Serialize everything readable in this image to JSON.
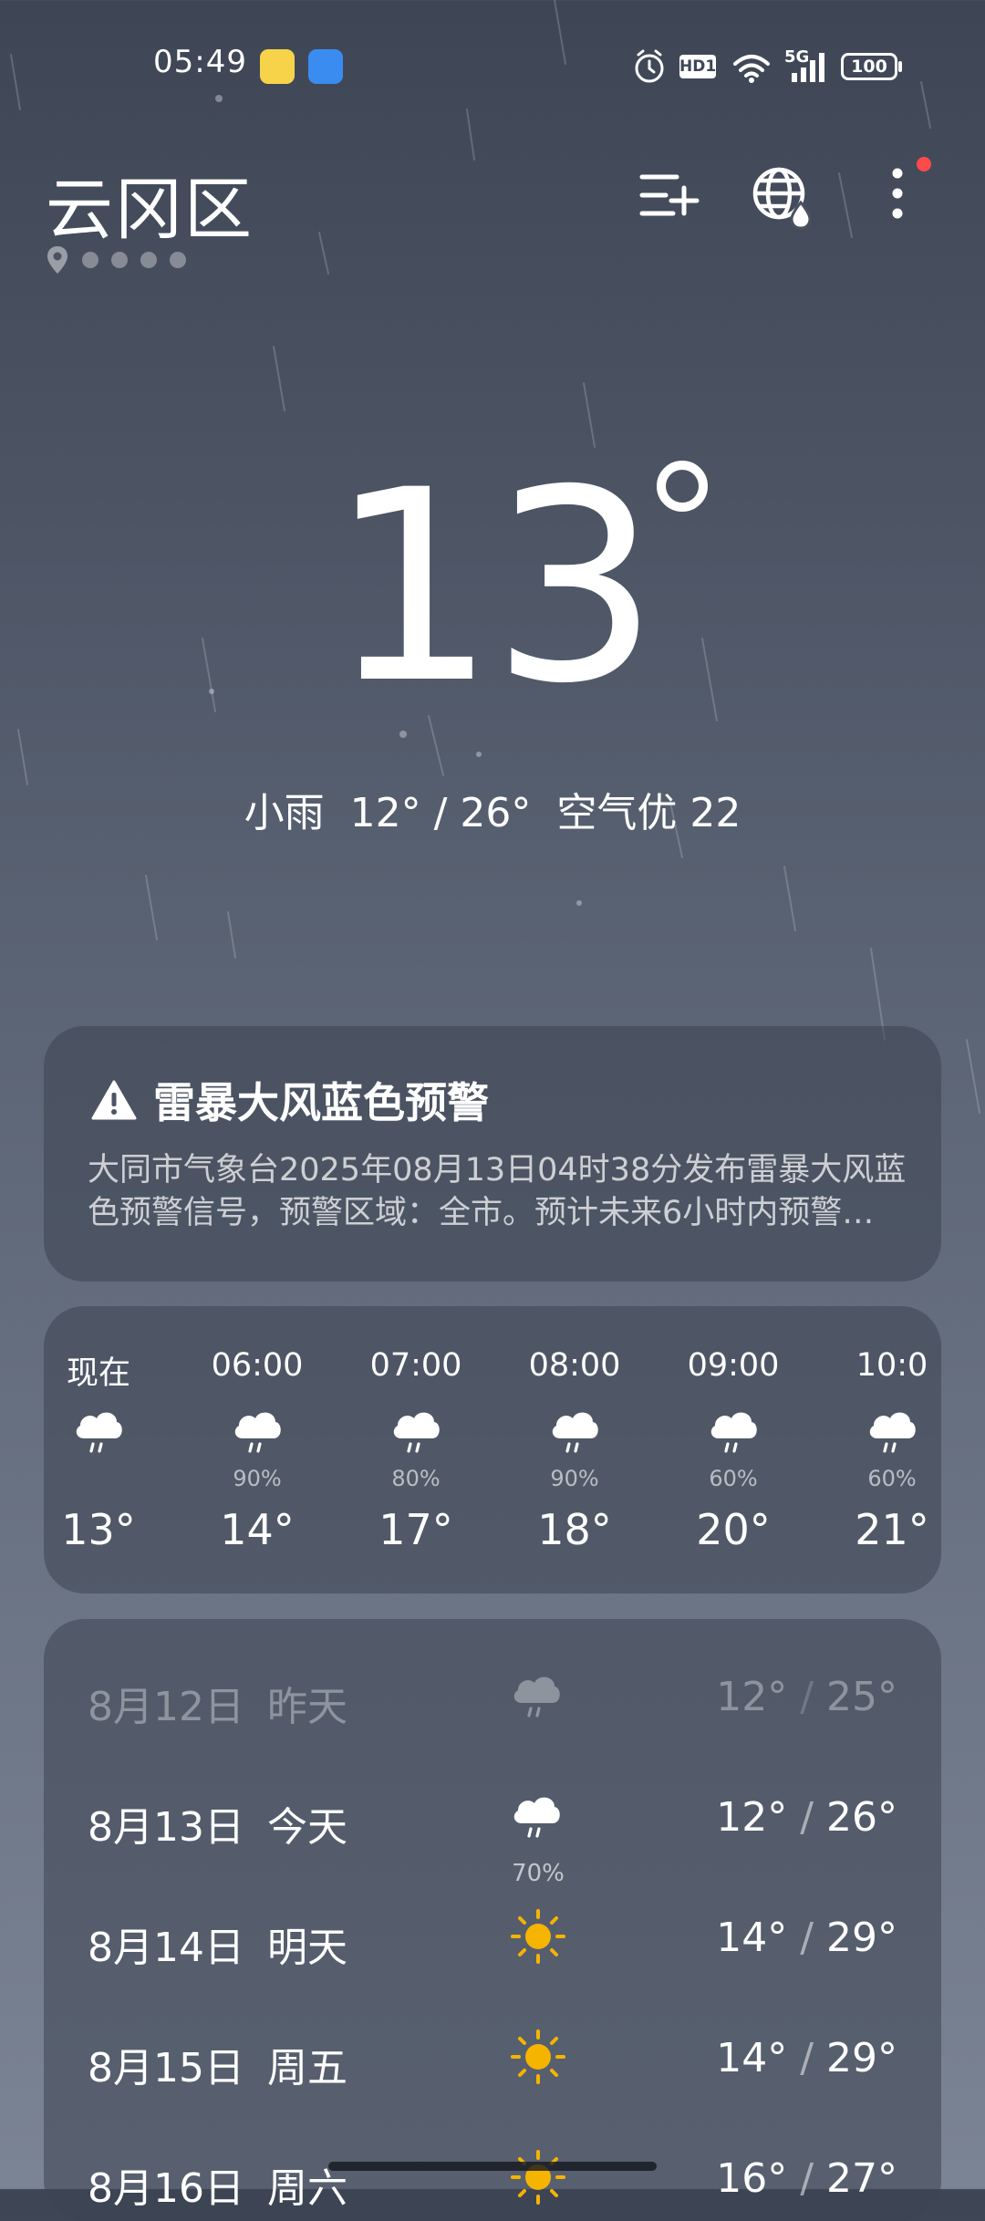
{
  "status_bar": {
    "time": "05:49",
    "network": "5G",
    "hd": "HD1",
    "battery": "100"
  },
  "header": {
    "city": "云冈区",
    "page_count": 5,
    "active_page": 0,
    "has_notification": true
  },
  "current": {
    "temperature": "13",
    "condition": "小雨",
    "low": "12°",
    "high": "26°",
    "air_quality": "空气优 22",
    "summary": "小雨  12° / 26°  空气优 22"
  },
  "alert": {
    "title": "雷暴大风蓝色预警",
    "line1": "大同市气象台2025年08月13日04时38分发布雷暴大风蓝",
    "line2": "色预警信号，预警区域：全市。预计未来6小时内预警…"
  },
  "hourly": [
    {
      "time": "现在",
      "icon": "rain-cloud-icon",
      "pop": "",
      "temp": "13°"
    },
    {
      "time": "06:00",
      "icon": "rain-cloud-icon",
      "pop": "90%",
      "temp": "14°"
    },
    {
      "time": "07:00",
      "icon": "rain-cloud-icon",
      "pop": "80%",
      "temp": "17°"
    },
    {
      "time": "08:00",
      "icon": "rain-cloud-icon",
      "pop": "90%",
      "temp": "18°"
    },
    {
      "time": "09:00",
      "icon": "rain-cloud-icon",
      "pop": "60%",
      "temp": "20°"
    },
    {
      "time": "10:0",
      "icon": "rain-cloud-icon",
      "pop": "60%",
      "temp": "21°"
    }
  ],
  "daily": [
    {
      "date": "8月12日",
      "label": "昨天",
      "icon": "rain-cloud-icon",
      "pop": "",
      "low": "12°",
      "high": "25°",
      "past": true
    },
    {
      "date": "8月13日",
      "label": "今天",
      "icon": "rain-cloud-icon",
      "pop": "70%",
      "low": "12°",
      "high": "26°",
      "past": false
    },
    {
      "date": "8月14日",
      "label": "明天",
      "icon": "sun-icon",
      "pop": "",
      "low": "14°",
      "high": "29°",
      "past": false
    },
    {
      "date": "8月15日",
      "label": "周五",
      "icon": "sun-icon",
      "pop": "",
      "low": "14°",
      "high": "29°",
      "past": false
    },
    {
      "date": "8月16日",
      "label": "周六",
      "icon": "sun-icon",
      "pop": "",
      "low": "16°",
      "high": "27°",
      "past": false
    }
  ],
  "colors": {
    "accent_sun": "#f5b400",
    "notification": "#ff4a4a"
  }
}
